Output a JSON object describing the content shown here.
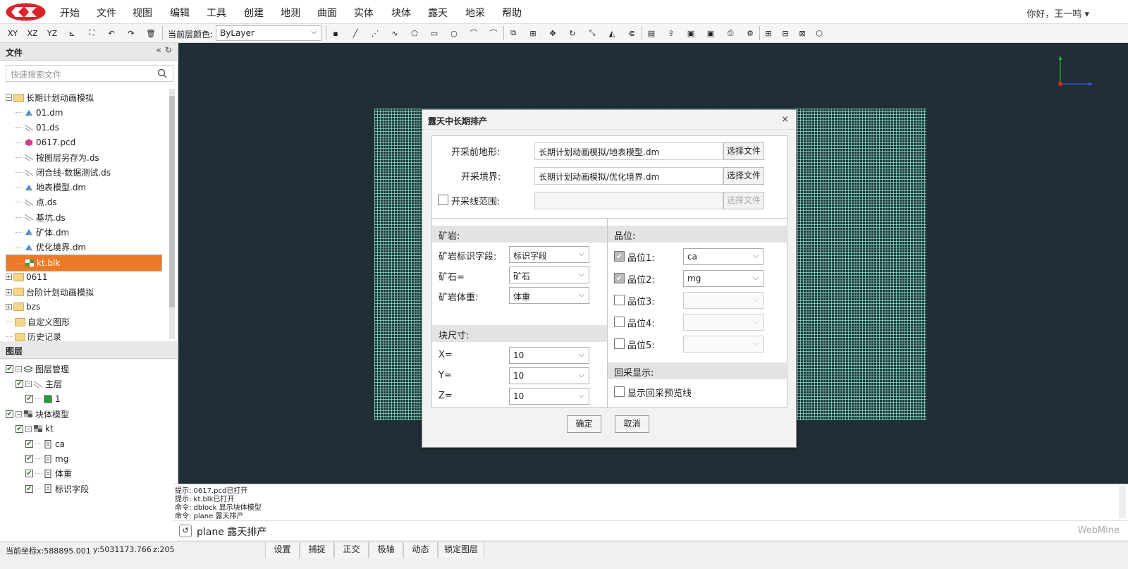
{
  "menu": [
    "开始",
    "文件",
    "视图",
    "编辑",
    "工具",
    "创建",
    "地测",
    "曲面",
    "实体",
    "块体",
    "露天",
    "地采",
    "帮助"
  ],
  "user": "你好，王一鸣 ▾",
  "toolbar": {
    "axis_buttons": [
      "XY",
      "XZ",
      "YZ"
    ],
    "color_label": "当前层颜色:",
    "color_value": "ByLayer"
  },
  "file_panel": {
    "title": "文件",
    "search_placeholder": "快速搜索文件",
    "items": [
      {
        "name": "长期计划动画模拟",
        "type": "folder",
        "expand": "−",
        "level": 0
      },
      {
        "name": "01.dm",
        "type": "dm",
        "level": 1
      },
      {
        "name": "01.ds",
        "type": "ds",
        "level": 1
      },
      {
        "name": "0617.pcd",
        "type": "pcd",
        "level": 1
      },
      {
        "name": "按图层另存为.ds",
        "type": "ds",
        "level": 1
      },
      {
        "name": "闭合线-数据测试.ds",
        "type": "ds",
        "level": 1
      },
      {
        "name": "地表模型.dm",
        "type": "dm",
        "level": 1
      },
      {
        "name": "点.ds",
        "type": "ds",
        "level": 1
      },
      {
        "name": "基坑.ds",
        "type": "ds",
        "level": 1
      },
      {
        "name": "矿体.dm",
        "type": "dm",
        "level": 1
      },
      {
        "name": "优化境界.dm",
        "type": "dm",
        "level": 1
      },
      {
        "name": "kt.blk",
        "type": "blk",
        "level": 1,
        "selected": true
      },
      {
        "name": "0611",
        "type": "folder",
        "expand": "+",
        "level": 0
      },
      {
        "name": "台阶计划动画模拟",
        "type": "folder",
        "expand": "+",
        "level": 0
      },
      {
        "name": "bzs",
        "type": "folder",
        "expand": "+",
        "level": 0
      },
      {
        "name": "自定义图形",
        "type": "folder",
        "level": 0
      },
      {
        "name": "历史记录",
        "type": "folder",
        "level": 0
      }
    ]
  },
  "layer_panel": {
    "title": "图层",
    "items": [
      {
        "name": "图层管理",
        "level": 0,
        "icon": "layers"
      },
      {
        "name": "主层",
        "level": 1,
        "icon": "ds"
      },
      {
        "name": "1",
        "level": 2,
        "icon": "green"
      },
      {
        "name": "块体模型",
        "level": 0,
        "icon": "blk"
      },
      {
        "name": "kt",
        "level": 1,
        "icon": "blk"
      },
      {
        "name": "ca",
        "level": 2,
        "icon": "doc"
      },
      {
        "name": "mg",
        "level": 2,
        "icon": "doc"
      },
      {
        "name": "体重",
        "level": 2,
        "icon": "doc"
      },
      {
        "name": "标识字段",
        "level": 2,
        "icon": "doc"
      }
    ]
  },
  "dialog": {
    "title": "露天中长期排产",
    "close": "×",
    "pre_terrain_label": "开采前地形:",
    "pre_terrain_value": "长期计划动画模拟/地表模型.dm",
    "boundary_label": "开采境界:",
    "boundary_value": "长期计划动画模拟/优化境界.dm",
    "line_range_label": "开采线范围:",
    "choose_file": "选择文件",
    "ore_section": "矿岩:",
    "ore_field_label": "矿岩标识字段:",
    "ore_field_value": "标识字段",
    "ore_label": "矿石=",
    "ore_value": "矿石",
    "density_label": "矿岩体重:",
    "density_value": "体重",
    "block_section": "块尺寸:",
    "x_label": "X=",
    "x_value": "10",
    "y_label": "Y=",
    "y_value": "10",
    "z_label": "Z=",
    "z_value": "10",
    "grade_section": "品位:",
    "grades": [
      {
        "label": "品位1:",
        "value": "ca",
        "checked": true
      },
      {
        "label": "品位2:",
        "value": "mg",
        "checked": true
      },
      {
        "label": "品位3:",
        "value": "",
        "checked": false
      },
      {
        "label": "品位4:",
        "value": "",
        "checked": false
      },
      {
        "label": "品位5:",
        "value": "",
        "checked": false
      }
    ],
    "backfill_section": "回采显示:",
    "backfill_label": "显示回采预览线",
    "ok": "确定",
    "cancel": "取消"
  },
  "log": [
    "提示:   0617.pcd已打开",
    "提示:   kt.blk已打开",
    "命令:   dblock 显示块体模型",
    "命令:   plane 露天排产"
  ],
  "command": "plane 露天排产",
  "brand": "WebMine",
  "status": {
    "coord_x": "当前坐标x:588895.001",
    "coord_y": "y:5031173.766",
    "coord_z": "z:205",
    "buttons": [
      "设置",
      "捕捉",
      "正交",
      "极轴",
      "动态",
      "锁定图层"
    ]
  },
  "colors": {
    "accent": "#ef7a26",
    "viewport": "#1f2f35",
    "grid": "#8cdcc8",
    "logo": "#d8232a"
  }
}
